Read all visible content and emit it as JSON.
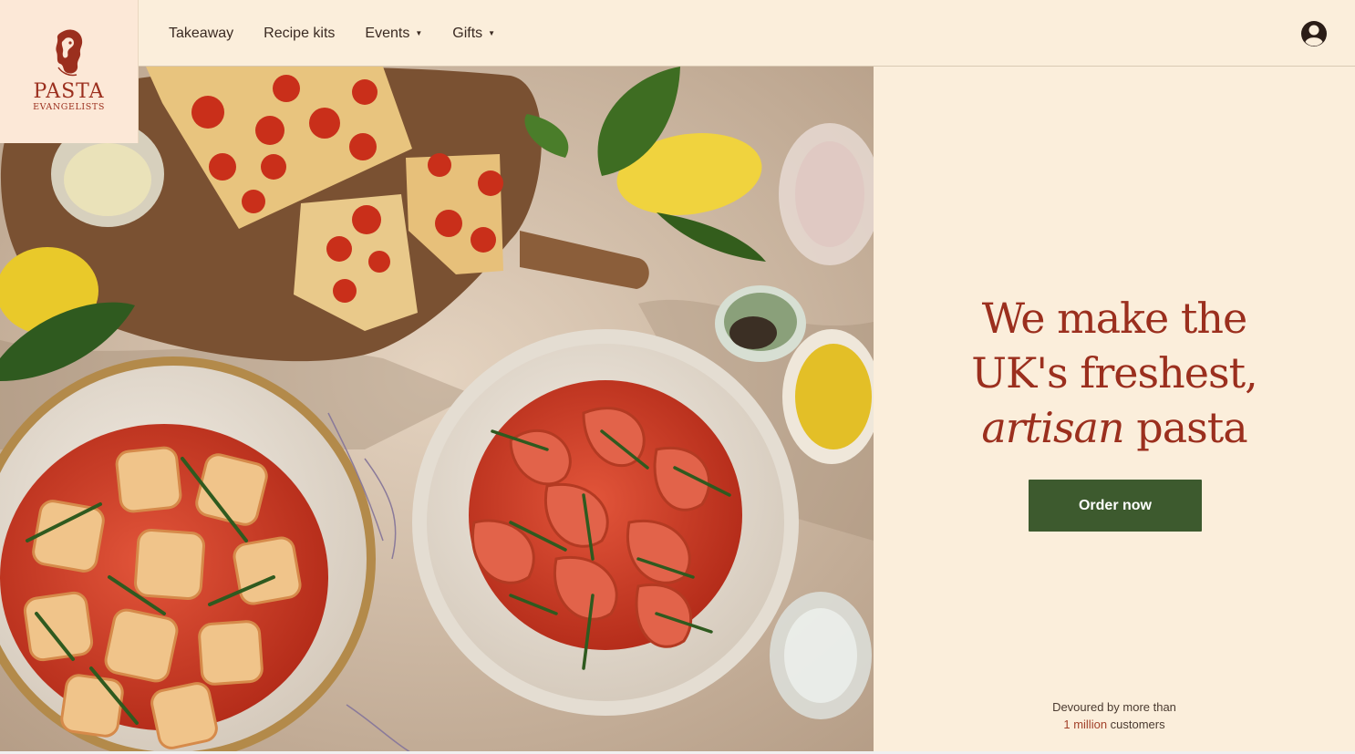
{
  "brand": {
    "name": "PASTA",
    "subtitle": "EVANGELISTS",
    "color": "#9b2f1e"
  },
  "nav": {
    "items": [
      {
        "label": "Takeaway",
        "has_dropdown": false
      },
      {
        "label": "Recipe kits",
        "has_dropdown": false
      },
      {
        "label": "Events",
        "has_dropdown": true
      },
      {
        "label": "Gifts",
        "has_dropdown": true
      }
    ],
    "account_icon": "user-account-icon"
  },
  "hero": {
    "image_icon": "pasta-dishes-photo",
    "headline_line1": "We make the",
    "headline_line2": "UK's freshest,",
    "headline_line3_italic": "artisan",
    "headline_line3_rest": " pasta",
    "cta_label": "Order now",
    "cta_color": "#3d5a2e",
    "social_line1": "Devoured by more than",
    "social_highlight": "1 million",
    "social_rest": " customers"
  },
  "colors": {
    "background": "#FBEEDB",
    "accent": "#9b2f1e"
  }
}
